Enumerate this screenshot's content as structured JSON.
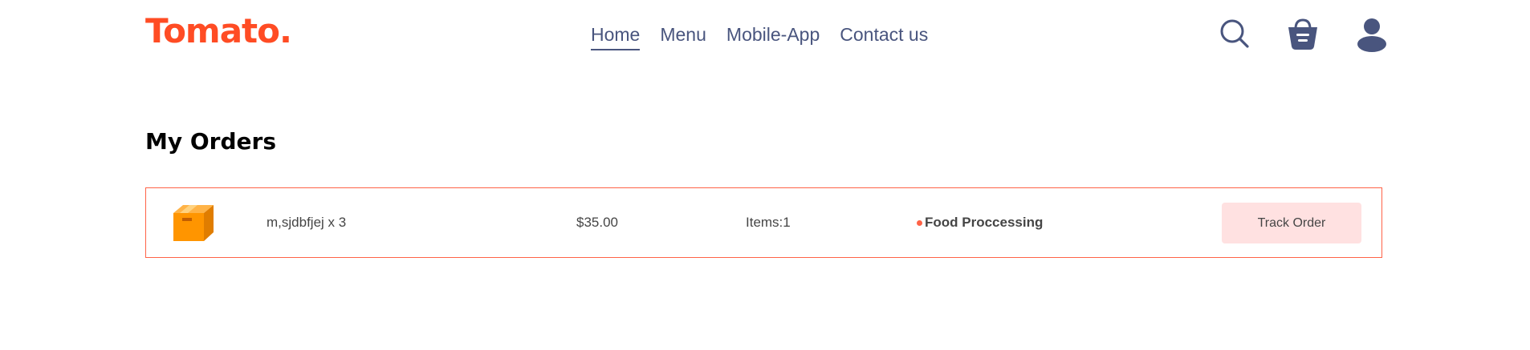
{
  "navbar": {
    "logo": "Tomato.",
    "menu": [
      {
        "label": "Home",
        "active": true
      },
      {
        "label": "Menu",
        "active": false
      },
      {
        "label": "Mobile-App",
        "active": false
      },
      {
        "label": "Contact us",
        "active": false
      }
    ],
    "icons": [
      "search-icon",
      "basket-icon",
      "profile-icon"
    ]
  },
  "page": {
    "title": "My Orders"
  },
  "orders": [
    {
      "icon": "parcel-icon",
      "items_text": "m,sjdbfjej x 3",
      "amount": "$35.00",
      "items_count": "Items:1",
      "status": "Food Proccessing",
      "action_label": "Track Order"
    }
  ],
  "colors": {
    "brand": "#ff4c24",
    "nav_text": "#49557e",
    "order_border": "#ff6347",
    "button_bg": "#ffe1e1",
    "status_dot": "#ff6347"
  }
}
